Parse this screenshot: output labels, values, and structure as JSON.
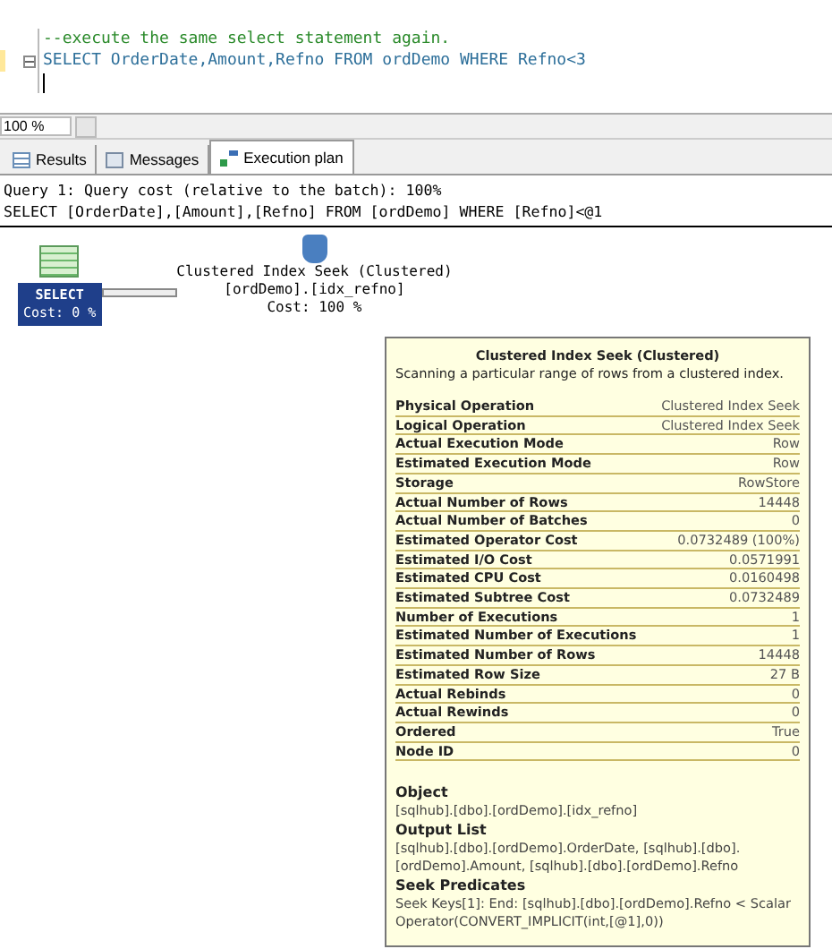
{
  "editor": {
    "lines": [
      {
        "kind": "comment",
        "text": "--execute the same select statement again."
      },
      {
        "kind": "sql",
        "text": "SELECT OrderDate,Amount,Refno FROM ordDemo WHERE Refno<3",
        "collapsible": true
      },
      {
        "kind": "cursor"
      }
    ]
  },
  "zoom": {
    "value": "100 %"
  },
  "tabs": [
    {
      "label": "Results",
      "selected": false
    },
    {
      "label": "Messages",
      "selected": false
    },
    {
      "label": "Execution plan",
      "selected": true
    }
  ],
  "plan_header": [
    "Query 1: Query cost (relative to the batch): 100%",
    "SELECT [OrderDate],[Amount],[Refno] FROM [ordDemo] WHERE [Refno]<@1"
  ],
  "nodes": [
    {
      "kind": "select",
      "label": "SELECT",
      "cost": "Cost: 0 %"
    },
    {
      "kind": "seek",
      "label": "Clustered Index Seek (Clustered)",
      "object": "[ordDemo].[idx_refno]",
      "cost": "Cost: 100 %"
    }
  ],
  "tooltip": {
    "title": "Clustered Index Seek (Clustered)",
    "description": "Scanning a particular range of rows from a clustered index.",
    "properties": [
      {
        "name": "Physical Operation",
        "value": "Clustered Index Seek"
      },
      {
        "name": "Logical Operation",
        "value": "Clustered Index Seek"
      },
      {
        "name": "Actual Execution Mode",
        "value": "Row"
      },
      {
        "name": "Estimated Execution Mode",
        "value": "Row"
      },
      {
        "name": "Storage",
        "value": "RowStore"
      },
      {
        "name": "Actual Number of Rows",
        "value": "14448"
      },
      {
        "name": "Actual Number of Batches",
        "value": "0"
      },
      {
        "name": "Estimated Operator Cost",
        "value": "0.0732489 (100%)"
      },
      {
        "name": "Estimated I/O Cost",
        "value": "0.0571991"
      },
      {
        "name": "Estimated CPU Cost",
        "value": "0.0160498"
      },
      {
        "name": "Estimated Subtree Cost",
        "value": "0.0732489"
      },
      {
        "name": "Number of Executions",
        "value": "1"
      },
      {
        "name": "Estimated Number of Executions",
        "value": "1"
      },
      {
        "name": "Estimated Number of Rows",
        "value": "14448"
      },
      {
        "name": "Estimated Row Size",
        "value": "27 B"
      },
      {
        "name": "Actual Rebinds",
        "value": "0"
      },
      {
        "name": "Actual Rewinds",
        "value": "0"
      },
      {
        "name": "Ordered",
        "value": "True"
      },
      {
        "name": "Node ID",
        "value": "0"
      }
    ],
    "sections": [
      {
        "heading": "Object",
        "text": "[sqlhub].[dbo].[ordDemo].[idx_refno]"
      },
      {
        "heading": "Output List",
        "text": "[sqlhub].[dbo].[ordDemo].OrderDate, [sqlhub].[dbo].[ordDemo].Amount, [sqlhub].[dbo].[ordDemo].Refno"
      },
      {
        "heading": "Seek Predicates",
        "text": "Seek Keys[1]: End: [sqlhub].[dbo].[ordDemo].Refno < Scalar Operator(CONVERT_IMPLICIT(int,[@1],0))"
      }
    ]
  }
}
